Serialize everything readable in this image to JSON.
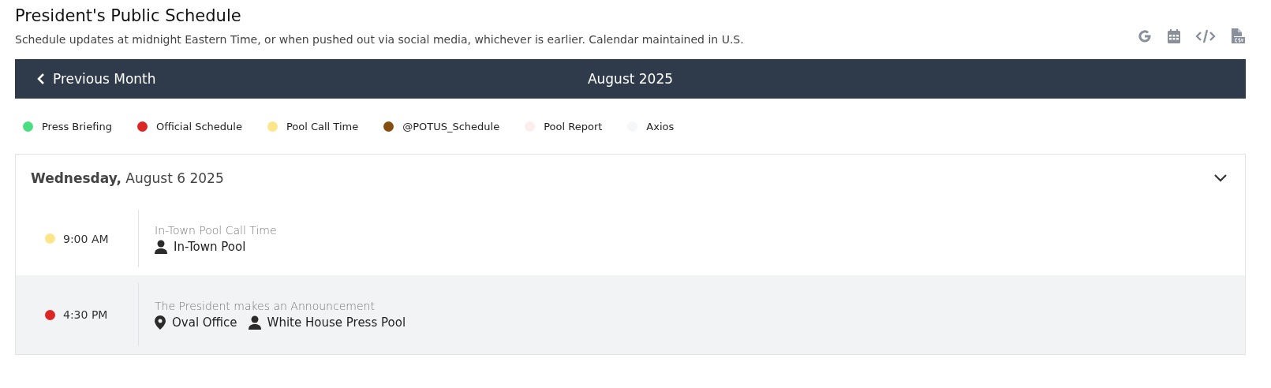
{
  "header": {
    "title": "President's Public Schedule",
    "subtitle": "Schedule updates at midnight Eastern Time, or when pushed out via social media, whichever is earlier. Calendar maintained in U.S."
  },
  "toolbar": [
    {
      "kind": "google"
    },
    {
      "kind": "calendar"
    },
    {
      "kind": "code"
    },
    {
      "kind": "csv"
    }
  ],
  "nav": {
    "previous": "Previous Month",
    "month": "August 2025"
  },
  "legend": [
    {
      "label": "Press Briefing",
      "color": "#4ade80"
    },
    {
      "label": "Official Schedule",
      "color": "#dc2626"
    },
    {
      "label": "Pool Call Time",
      "color": "#fde68a"
    },
    {
      "label": "@POTUS_Schedule",
      "color": "#854d0e"
    },
    {
      "label": "Pool Report",
      "color": "#fdeeee"
    },
    {
      "label": "Axios",
      "color": "#f6f7f9"
    }
  ],
  "day": {
    "heading": "**Wednesday,** August 6 2025",
    "expanded": true,
    "events": [
      {
        "time": "9:00 AM",
        "color": "#fde68a",
        "title": "In-Town Pool Call Time",
        "details": [
          {
            "kind": "person",
            "text": "In-Town Pool"
          }
        ]
      },
      {
        "time": "4:30 PM",
        "color": "#dc2626",
        "title": "The President makes an Announcement",
        "details": [
          {
            "kind": "location",
            "text": "Oval Office"
          },
          {
            "kind": "person",
            "text": "White House Press Pool"
          }
        ]
      }
    ]
  }
}
